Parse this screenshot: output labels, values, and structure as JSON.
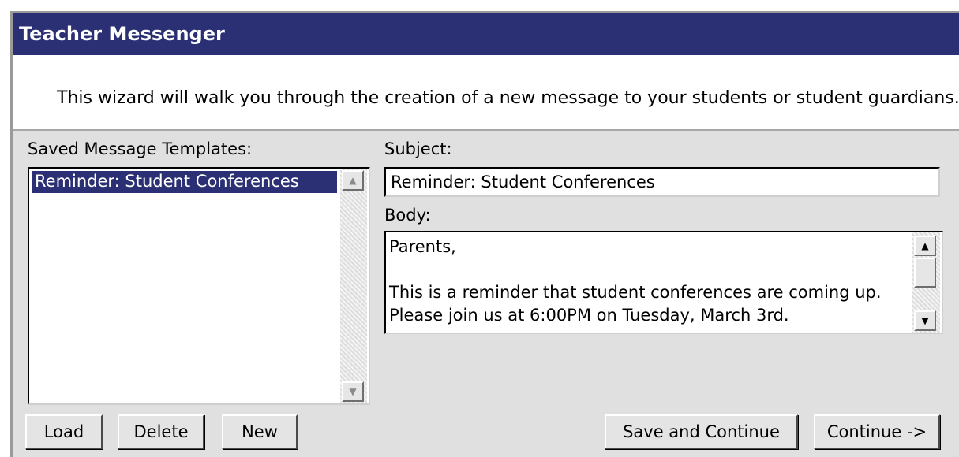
{
  "window": {
    "title": "Teacher Messenger",
    "intro": "This wizard will walk you through the creation of a new message to your students or student guardians."
  },
  "templates": {
    "label": "Saved Message Templates:",
    "items": [
      "Reminder: Student Conferences"
    ],
    "selected": "Reminder: Student Conferences"
  },
  "subject": {
    "label": "Subject:",
    "value": "Reminder: Student Conferences"
  },
  "body": {
    "label": "Body:",
    "value": "Parents,\n\nThis is a reminder that student conferences are coming up.\nPlease join us at 6:00PM on Tuesday, March 3rd."
  },
  "buttons": {
    "load": "Load",
    "delete": "Delete",
    "new": "New",
    "save_continue": "Save and Continue",
    "continue": "Continue ->"
  },
  "colors": {
    "titlebar": "#2b2f73",
    "selection": "#2b2f73",
    "panel": "#e0e0e0"
  }
}
